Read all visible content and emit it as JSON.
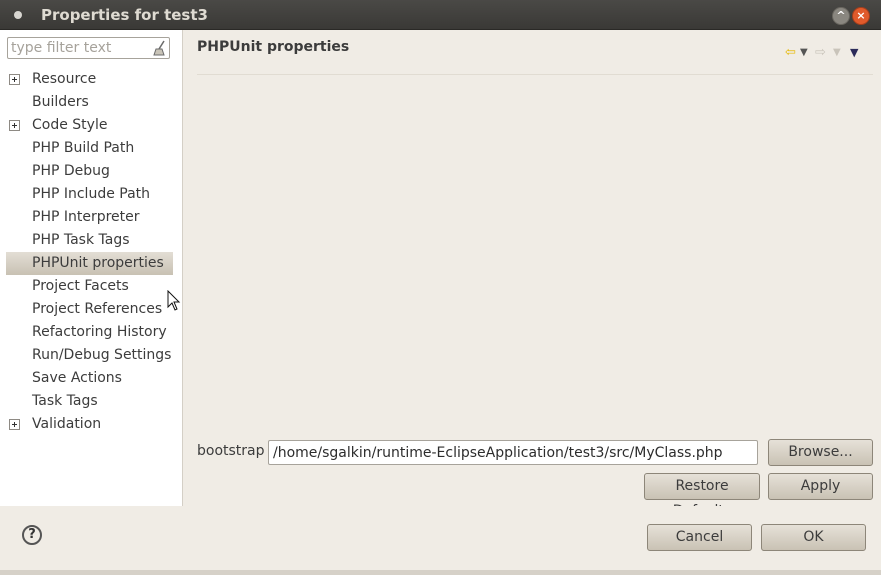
{
  "window": {
    "title": "Properties for test3"
  },
  "sidebar": {
    "filter_placeholder": "type filter text",
    "items": [
      {
        "label": "Resource",
        "expandable": true
      },
      {
        "label": "Builders",
        "expandable": false
      },
      {
        "label": "Code Style",
        "expandable": true
      },
      {
        "label": "PHP Build Path",
        "expandable": false
      },
      {
        "label": "PHP Debug",
        "expandable": false
      },
      {
        "label": "PHP Include Path",
        "expandable": false
      },
      {
        "label": "PHP Interpreter",
        "expandable": false
      },
      {
        "label": "PHP Task Tags",
        "expandable": false
      },
      {
        "label": "PHPUnit properties",
        "expandable": false,
        "selected": true
      },
      {
        "label": "Project Facets",
        "expandable": false
      },
      {
        "label": "Project References",
        "expandable": false
      },
      {
        "label": "Refactoring History",
        "expandable": false
      },
      {
        "label": "Run/Debug Settings",
        "expandable": false
      },
      {
        "label": "Save Actions",
        "expandable": false
      },
      {
        "label": "Task Tags",
        "expandable": false
      },
      {
        "label": "Validation",
        "expandable": true
      }
    ]
  },
  "page": {
    "title": "PHPUnit properties",
    "bootstrap_label": "bootstrap",
    "bootstrap_value": "/home/sgalkin/runtime-EclipseApplication/test3/src/MyClass.php",
    "browse_label": "Browse...",
    "restore_defaults_label": "Restore Defaults",
    "apply_label": "Apply"
  },
  "footer": {
    "cancel_label": "Cancel",
    "ok_label": "OK"
  },
  "colors": {
    "accent_back_arrow": "#e6b800",
    "selection": "#c8c1b3",
    "close_button": "#e05a2b"
  }
}
